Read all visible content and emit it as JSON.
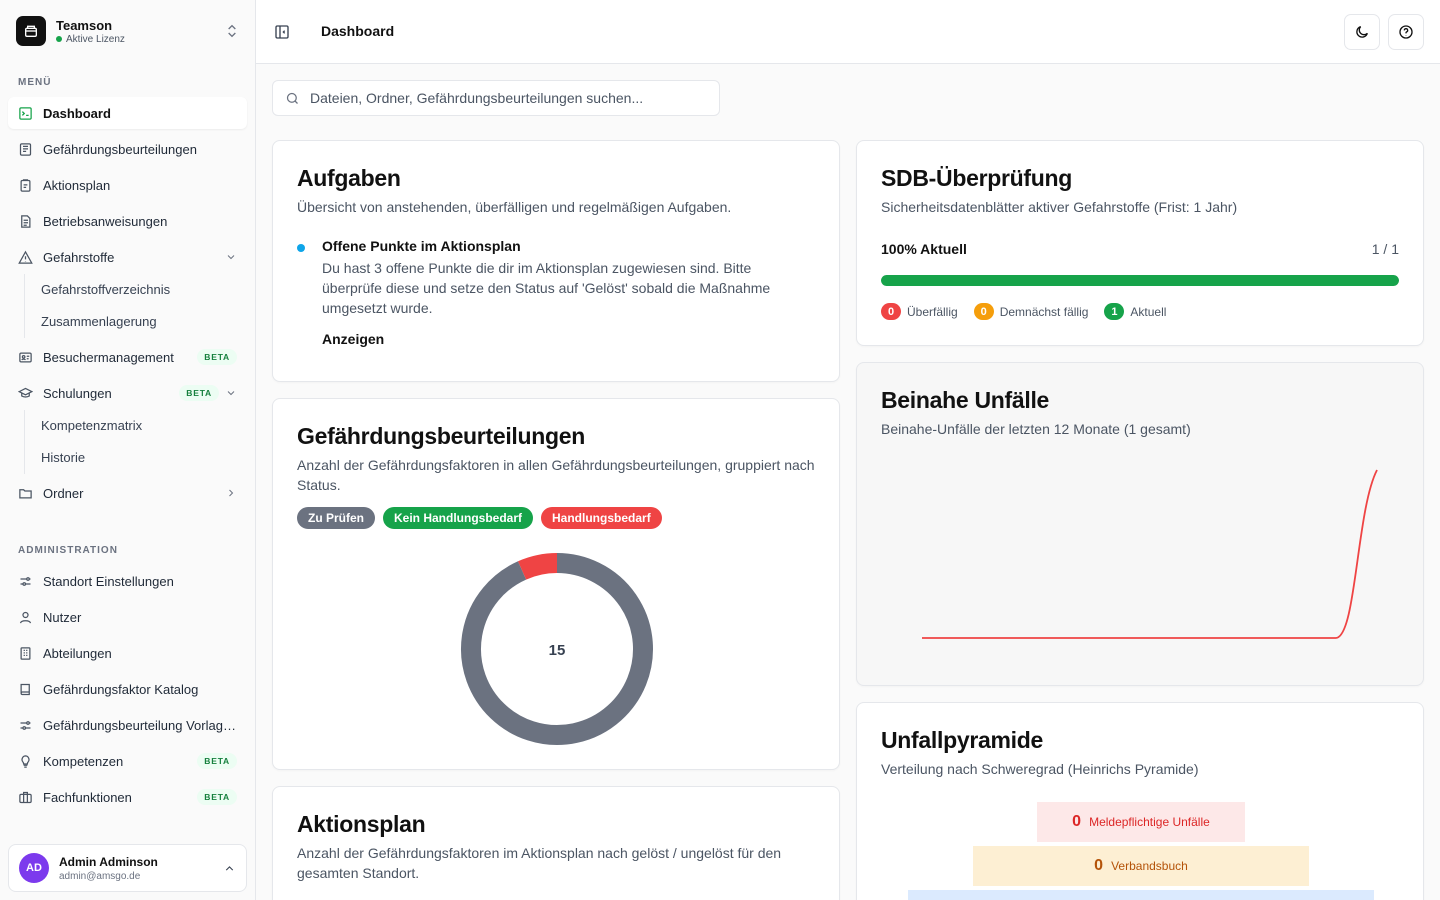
{
  "brand": {
    "name": "Teamson",
    "license": "Aktive Lizenz"
  },
  "sidebar": {
    "menu_label": "MENÜ",
    "admin_label": "ADMINISTRATION",
    "items": {
      "dashboard": "Dashboard",
      "gbu": "Gefährdungsbeurteilungen",
      "aktionsplan": "Aktionsplan",
      "betriebsanweisungen": "Betriebsanweisungen",
      "gefahrstoffe": "Gefahrstoffe",
      "gefahrstoffverzeichnis": "Gefahrstoffverzeichnis",
      "zusammenlagerung": "Zusammenlagerung",
      "besucher": "Besuchermanagement",
      "schulungen": "Schulungen",
      "kompetenzmatrix": "Kompetenzmatrix",
      "historie": "Historie",
      "ordner": "Ordner",
      "standort": "Standort Einstellungen",
      "nutzer": "Nutzer",
      "abteilungen": "Abteilungen",
      "katalog": "Gefährdungsfaktor Katalog",
      "vorlagen": "Gefährdungsbeurteilung Vorlagen",
      "kompetenzen": "Kompetenzen",
      "fachfunktionen": "Fachfunktionen"
    },
    "beta": "BETA"
  },
  "user": {
    "initials": "AD",
    "name": "Admin Adminson",
    "email": "admin@amsgo.de"
  },
  "header": {
    "title": "Dashboard"
  },
  "search": {
    "placeholder": "Dateien, Ordner, Gefährdungsbeurteilungen suchen..."
  },
  "aufgaben": {
    "title": "Aufgaben",
    "desc": "Übersicht von anstehenden, überfälligen und regelmäßigen Aufgaben.",
    "task_title": "Offene Punkte im Aktionsplan",
    "task_desc": "Du hast 3 offene Punkte die dir im Aktionsplan zugewiesen sind. Bitte überprüfe diese und setze den Status auf 'Gelöst' sobald die Maßnahme umgesetzt wurde.",
    "task_link": "Anzeigen"
  },
  "gbu_card": {
    "title": "Gefährdungsbeurteilungen",
    "desc": "Anzahl der Gefährdungsfaktoren in allen Gefährdungsbeurteilungen, gruppiert nach Status.",
    "legend": [
      "Zu Prüfen",
      "Kein Handlungsbedarf",
      "Handlungsbedarf"
    ],
    "total": "15"
  },
  "aktionsplan_card": {
    "title": "Aktionsplan",
    "desc": "Anzahl der Gefährdungsfaktoren im Aktionsplan nach gelöst / ungelöst für den gesamten Standort."
  },
  "sdb": {
    "title": "SDB-Überprüfung",
    "desc": "Sicherheitsdatenblätter aktiver Gefahrstoffe (Frist: 1 Jahr)",
    "progress_label": "100% Aktuell",
    "progress_count": "1 / 1",
    "progress": 1.0,
    "statuses": [
      {
        "count": "0",
        "label": "Überfällig",
        "color": "#ef4444"
      },
      {
        "count": "0",
        "label": "Demnächst fällig",
        "color": "#f59e0b"
      },
      {
        "count": "1",
        "label": "Aktuell",
        "color": "#16a34a"
      }
    ]
  },
  "beinahe": {
    "title": "Beinahe Unfälle",
    "desc": "Beinahe-Unfälle der letzten 12 Monate (1 gesamt)"
  },
  "pyramide": {
    "title": "Unfallpyramide",
    "desc": "Verteilung nach Schweregrad (Heinrichs Pyramide)",
    "rows": [
      {
        "count": "0",
        "label": "Meldepflichtige Unfälle"
      },
      {
        "count": "0",
        "label": "Verbandsbuch"
      }
    ]
  },
  "chart_data": [
    {
      "type": "pie",
      "categories": [
        "Zu Prüfen",
        "Kein Handlungsbedarf",
        "Handlungsbedarf"
      ],
      "values": [
        14,
        0,
        1
      ],
      "colors": [
        "#6b7280",
        "#16a34a",
        "#ef4444"
      ],
      "center_label": "15"
    },
    {
      "type": "line",
      "x": [
        1,
        2,
        3,
        4,
        5,
        6,
        7,
        8,
        9,
        10,
        11,
        12
      ],
      "values": [
        0,
        0,
        0,
        0,
        0,
        0,
        0,
        0,
        0,
        0,
        0,
        1
      ],
      "color": "#ef4444",
      "grid": false
    }
  ]
}
